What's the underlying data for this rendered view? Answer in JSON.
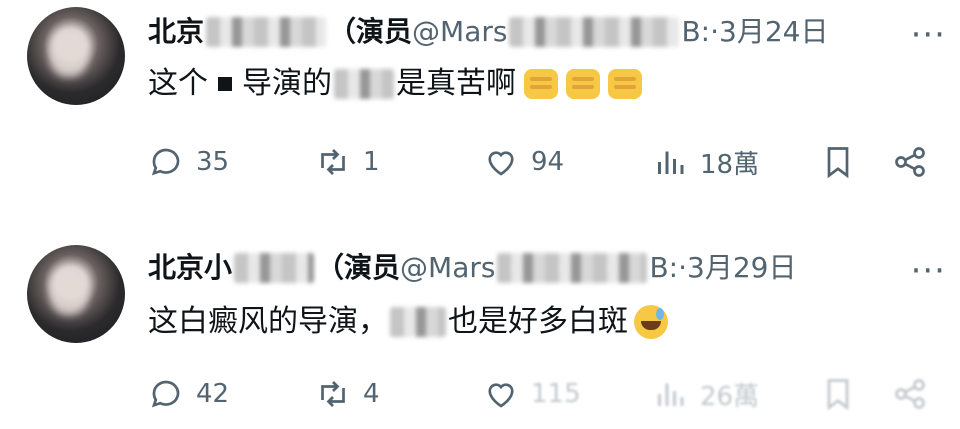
{
  "posts": [
    {
      "name_prefix": "北京",
      "name_suffix": "（演员",
      "handle": "@Mars",
      "handle_tail": "B:",
      "sep": "·",
      "date": "3月24日",
      "more": "···",
      "text_a": "这个",
      "text_b": "导演的",
      "text_c": "是真苦啊",
      "replies": "35",
      "reposts": "1",
      "likes": "94",
      "views": "18萬"
    },
    {
      "name_prefix": "北京小",
      "name_suffix": "（演员",
      "handle": "@Mars",
      "handle_tail": "B:",
      "sep": "·",
      "date": "3月29日",
      "more": "···",
      "text_a": "这白癜风的导演，",
      "text_b": "",
      "text_c": "也是好多白斑",
      "replies": "42",
      "reposts": "4",
      "likes": "115",
      "views": "26萬"
    }
  ],
  "icons": [
    "reply-icon",
    "repost-icon",
    "like-icon",
    "views-icon",
    "bookmark-icon",
    "share-icon",
    "more-icon"
  ]
}
